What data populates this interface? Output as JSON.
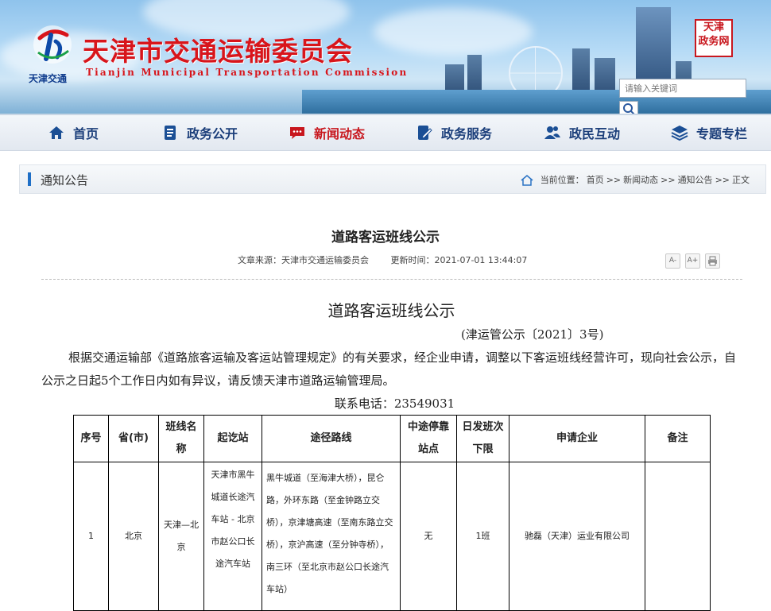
{
  "header": {
    "site_title": "天津市交通运输委员会",
    "site_title_en": "Tianjin Municipal Transportation Commission",
    "logo_sub": "天津交通",
    "seal_line1": "天津",
    "seal_line2": "政务网",
    "search_placeholder": "请输入关键词"
  },
  "nav": [
    {
      "label": "首页",
      "icon": "home-icon"
    },
    {
      "label": "政务公开",
      "icon": "document-icon"
    },
    {
      "label": "新闻动态",
      "icon": "chat-icon",
      "active": true
    },
    {
      "label": "政务服务",
      "icon": "edit-icon"
    },
    {
      "label": "政民互动",
      "icon": "users-icon"
    },
    {
      "label": "专题专栏",
      "icon": "layers-icon"
    }
  ],
  "section": {
    "title": "通知公告",
    "crumb_prefix": "当前位置：",
    "crumbs": [
      "首页",
      "新闻动态",
      "通知公告",
      "正文"
    ],
    "separator": ">>"
  },
  "article": {
    "title": "道路客运班线公示",
    "source": "文章来源：天津市交通运输委员会",
    "updated": "更新时间：2021-07-01 13:44:07",
    "font_larger": "A+",
    "font_smaller": "A-",
    "print": "打印",
    "body_title": "道路客运班线公示",
    "doc_no": "(津运管公示〔2021〕3号)",
    "paragraph": "根据交通运输部《道路旅客运输及客运站管理规定》的有关要求，经企业申请，调整以下客运班线经营许可，现向社会公示，自公示之日起5个工作日内如有异议，请反馈天津市道路运输管理局。",
    "phone": "联系电话：23549031"
  },
  "table": {
    "headers": {
      "no": "序号",
      "province": "省(市)",
      "line": "班线名称",
      "stations": "起讫站",
      "route": "途径路线",
      "stops": "中途停靠站点",
      "freq": "日发班次下限",
      "company": "申请企业",
      "note": "备注"
    },
    "rows": [
      {
        "no": "1",
        "province": "北京",
        "line": "天津—北京",
        "stations": "天津市黑牛城道长途汽车站 - 北京市赵公口长途汽车站",
        "route": "黑牛城道（至海津大桥），昆仑路，外环东路（至金钟路立交桥），京津塘高速（至南东路立交桥），京沪高速（至分钟寺桥），南三环（至北京市赵公口长途汽车站）",
        "stops": "无",
        "freq": "1班",
        "company": "驰磊（天津）运业有限公司",
        "note": ""
      }
    ]
  }
}
